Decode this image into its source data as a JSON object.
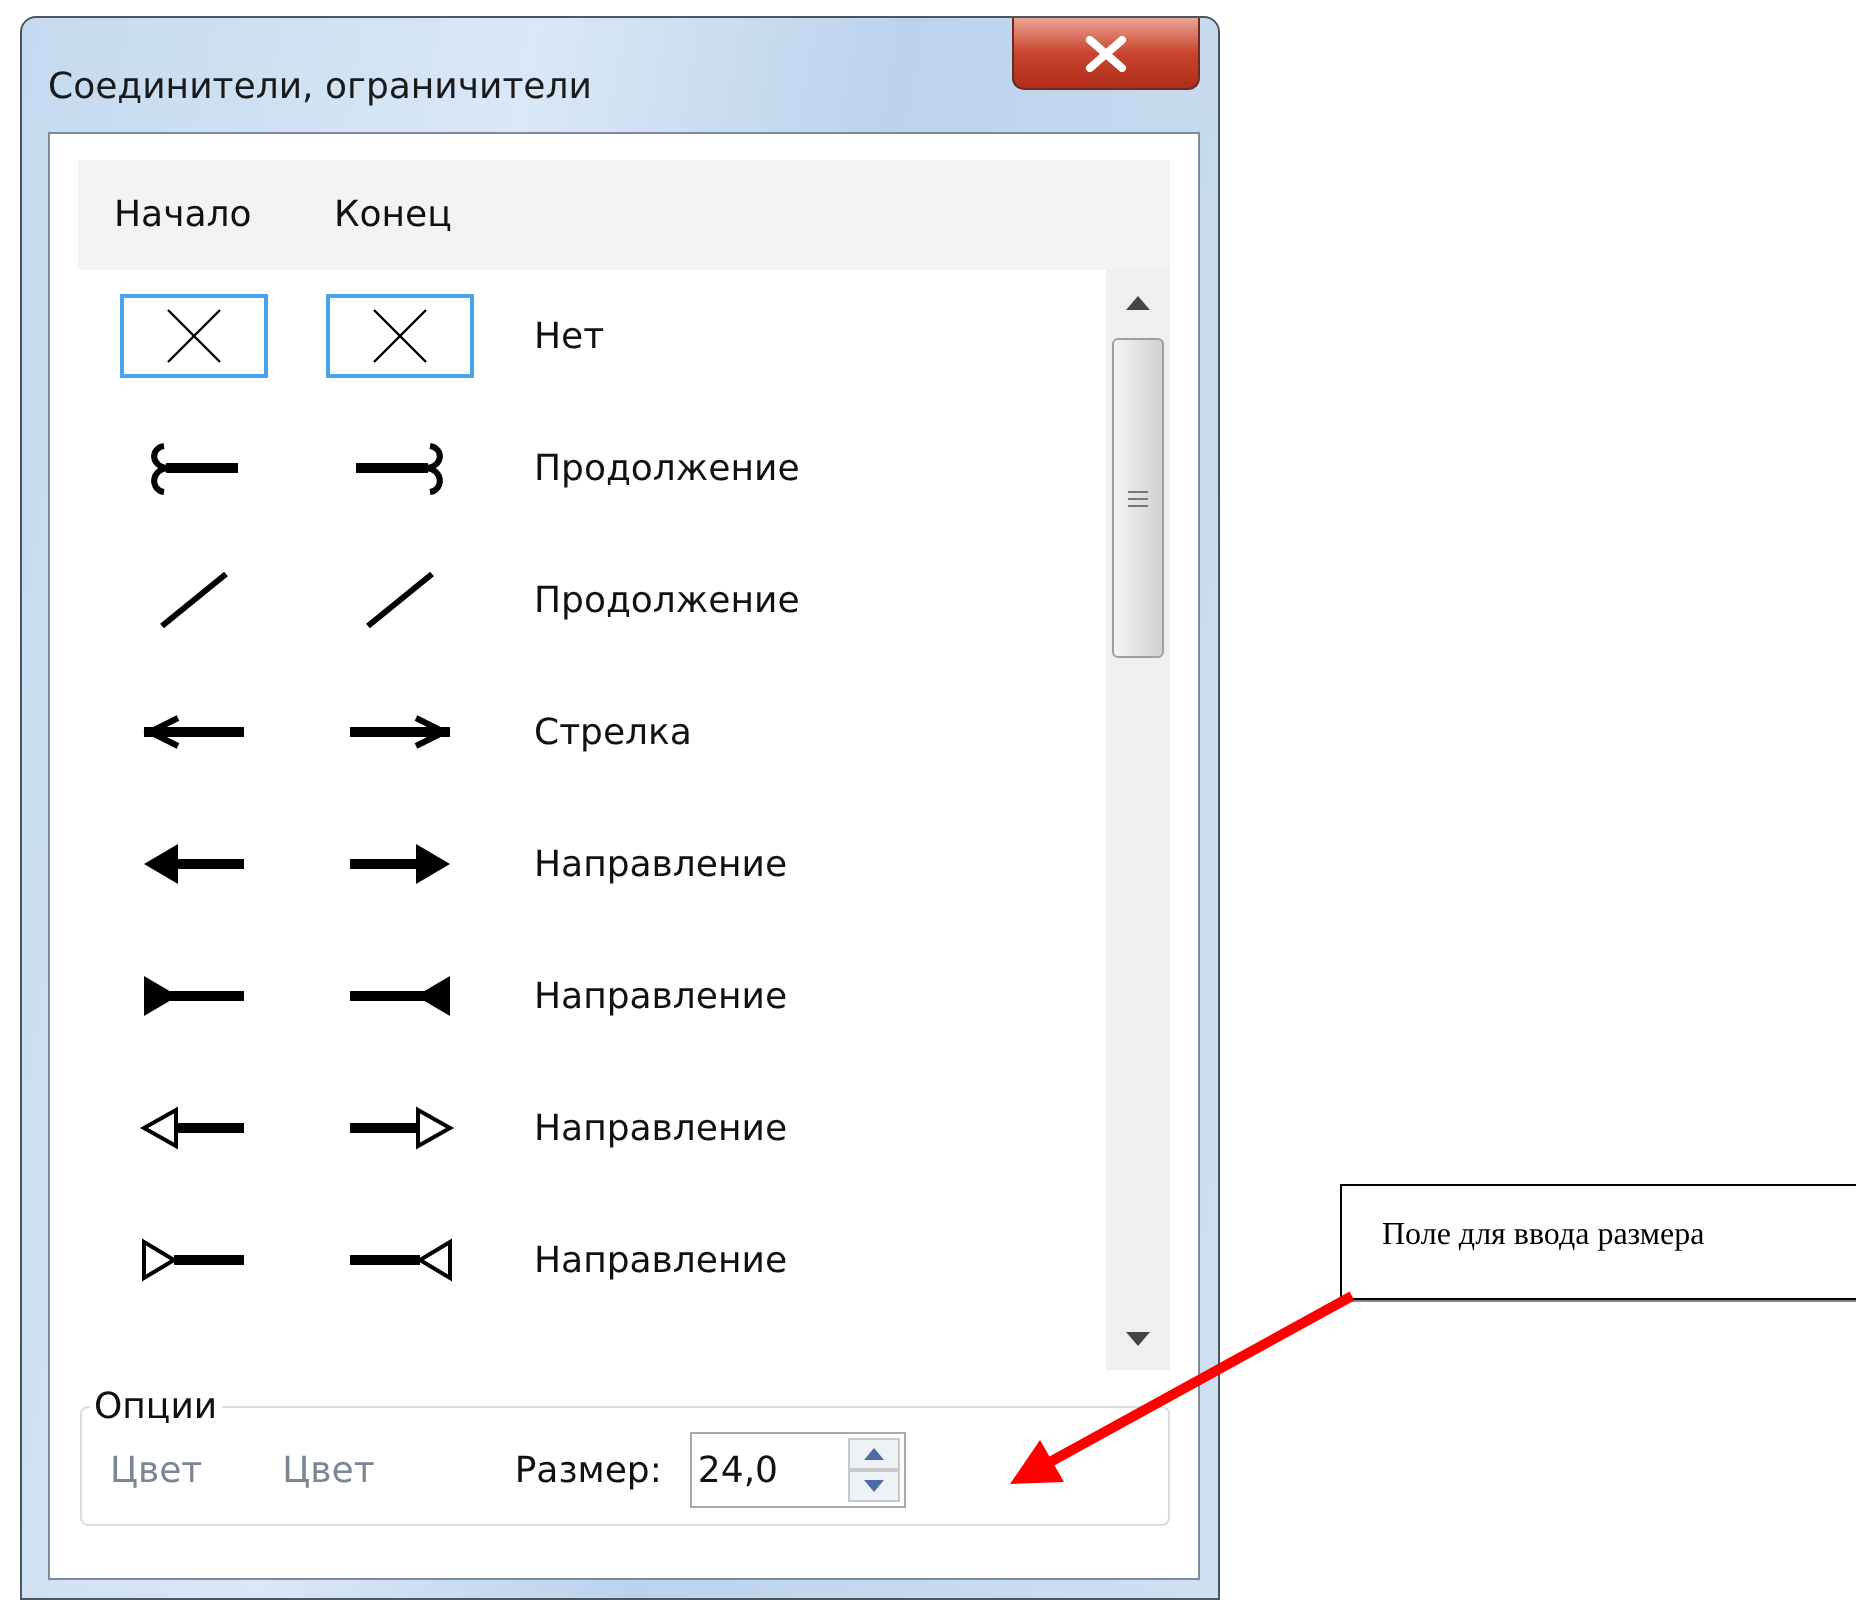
{
  "window": {
    "title": "Соединители, ограничители"
  },
  "columns": [
    "Начало",
    "Конец"
  ],
  "rows": [
    {
      "label": "Нет",
      "start": {
        "kind": "none",
        "selected": true
      },
      "end": {
        "kind": "none",
        "selected": true
      }
    },
    {
      "label": "Продолжение",
      "start": {
        "kind": "hook",
        "selected": false
      },
      "end": {
        "kind": "hook",
        "selected": false
      }
    },
    {
      "label": "Продолжение",
      "start": {
        "kind": "slash",
        "selected": false
      },
      "end": {
        "kind": "slash",
        "selected": false
      }
    },
    {
      "label": "Стрелка",
      "start": {
        "kind": "barb",
        "selected": false
      },
      "end": {
        "kind": "barb",
        "selected": false
      }
    },
    {
      "label": "Направление",
      "start": {
        "kind": "filled",
        "selected": false
      },
      "end": {
        "kind": "filled",
        "selected": false
      }
    },
    {
      "label": "Направление",
      "start": {
        "kind": "filled-reverse",
        "selected": false
      },
      "end": {
        "kind": "filled-reverse",
        "selected": false
      }
    },
    {
      "label": "Направление",
      "start": {
        "kind": "hollow",
        "selected": false
      },
      "end": {
        "kind": "hollow",
        "selected": false
      }
    },
    {
      "label": "Направление",
      "start": {
        "kind": "hollow-reverse",
        "selected": false
      },
      "end": {
        "kind": "hollow-reverse",
        "selected": false
      }
    }
  ],
  "options": {
    "title": "Опции",
    "color_buttons": [
      {
        "label": "Цвет",
        "disabled": true
      },
      {
        "label": "Цвет",
        "disabled": true
      }
    ],
    "size_label": "Размер:",
    "size_value": "24,0"
  },
  "annotation": {
    "text": "Поле для ввода размера"
  }
}
